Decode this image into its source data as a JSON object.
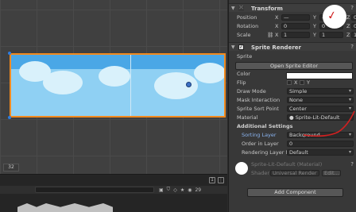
{
  "scene": {
    "badge": "32"
  },
  "console": {
    "count": "29",
    "bottom_icon_a": "1",
    "bottom_icon_b": "⋮"
  },
  "transform": {
    "title": "Transform",
    "position_label": "Position",
    "rotation_label": "Rotation",
    "scale_label": "Scale",
    "axis_x": "X",
    "axis_y": "Y",
    "axis_z": "Z",
    "pos_x": "—",
    "pos_y": "—",
    "pos_z": "0",
    "rot_x": "0",
    "rot_y": "0",
    "rot_z": "0",
    "scale_x": "1",
    "scale_y": "1",
    "scale_z": "1"
  },
  "sprite_renderer": {
    "title": "Sprite Renderer",
    "sprite_label": "Sprite",
    "open_editor": "Open Sprite Editor",
    "color_label": "Color",
    "flip_label": "Flip",
    "flip_x": "X",
    "flip_y": "Y",
    "draw_mode_label": "Draw Mode",
    "draw_mode_value": "Simple",
    "mask_label": "Mask Interaction",
    "mask_value": "None",
    "sort_point_label": "Sprite Sort Point",
    "sort_point_value": "Center",
    "material_label": "Material",
    "material_value": "Sprite-Lit-Default",
    "additional_settings": "Additional Settings",
    "sorting_layer_label": "Sorting Layer",
    "sorting_layer_value": "Background",
    "order_label": "Order in Layer",
    "order_value": "0",
    "rendering_layer_label": "Rendering Layer M",
    "rendering_layer_value": "Default"
  },
  "material_block": {
    "name": "Sprite-Lit-Default (Material)",
    "shader_label": "Shader",
    "shader_value": "Universal Render",
    "edit_label": "Edit..."
  },
  "add_component": "Add Component",
  "colors": {
    "accent_orange": "#f28a1e",
    "annotation_red": "#d02020",
    "sky_blue": "#8fd0f3"
  }
}
